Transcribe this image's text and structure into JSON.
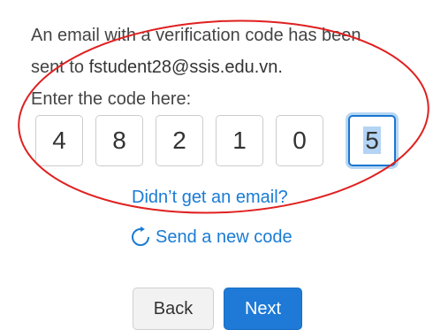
{
  "message": {
    "line1": "An email with a verification code has been",
    "line2_prefix": "sent to ",
    "email": "fstudent28@ssis.edu.vn.",
    "line3": "Enter the code here:"
  },
  "code": {
    "digits": [
      "4",
      "8",
      "2",
      "1",
      "0",
      "5"
    ],
    "active_index": 5
  },
  "links": {
    "no_email": "Didn’t get an email?",
    "resend": "Send a new code"
  },
  "buttons": {
    "back": "Back",
    "next": "Next"
  },
  "colors": {
    "accent": "#1e7ad6",
    "annotation": "#e02020"
  },
  "icons": {
    "resend": "refresh-arrow-icon"
  }
}
